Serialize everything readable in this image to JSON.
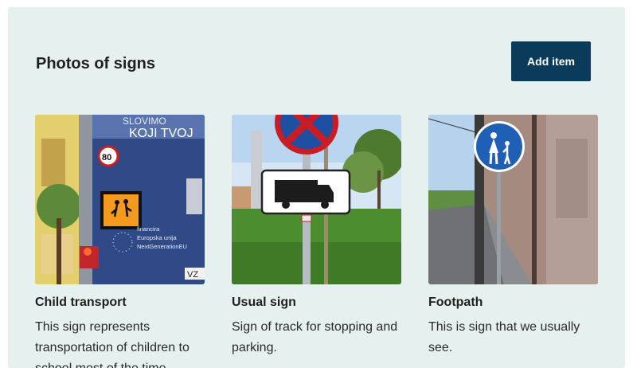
{
  "section": {
    "title": "Photos of signs",
    "add_button_label": "Add item"
  },
  "cards": [
    {
      "title": "Child transport",
      "description": "This sign represents transportation of children to school most of the time.",
      "image": {
        "bus_text_top": "SLOVIMO",
        "bus_text_main": "KOJI TVOJ",
        "speed_limit": "80",
        "eu_line1": "financira",
        "eu_line2": "Europska unija",
        "eu_line3": "NextGenerationEU",
        "plate_fragment": "VZ"
      }
    },
    {
      "title": "Usual sign",
      "description": "Sign of track for stopping and parking."
    },
    {
      "title": "Footpath",
      "description": "This is sign that we usually see."
    }
  ],
  "colors": {
    "panel_bg": "#e6f0ee",
    "button_bg": "#0b3b5a",
    "button_text": "#ffffff"
  }
}
